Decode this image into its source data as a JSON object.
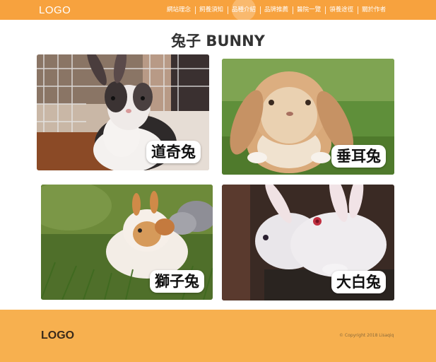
{
  "header": {
    "logo": "LOGO",
    "nav": [
      "網站理念",
      "飼養須知",
      "品種介紹",
      "品牌推薦",
      "醫院一覽",
      "領養途徑",
      "關於作者"
    ],
    "active_index": 2
  },
  "main": {
    "title": "兔子 BUNNY",
    "cards": [
      {
        "label": "道奇兔"
      },
      {
        "label": "垂耳兔"
      },
      {
        "label": "獅子兔"
      },
      {
        "label": "大白兔"
      }
    ]
  },
  "footer": {
    "logo": "LOGO",
    "copyright": "© Copyright 2018 Lisaqiq"
  },
  "colors": {
    "header_bg": "#f7a23e",
    "footer_bg": "#f7b04f"
  }
}
